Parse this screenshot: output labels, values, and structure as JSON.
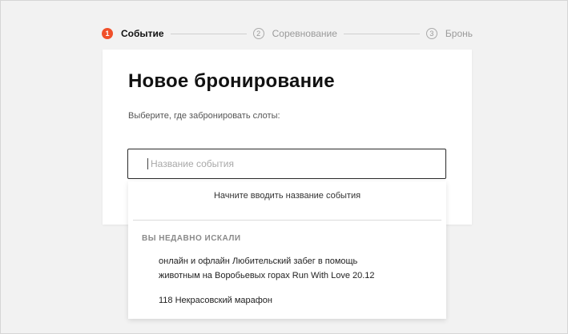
{
  "stepper": {
    "steps": [
      {
        "num": "1",
        "label": "Событие",
        "active": true
      },
      {
        "num": "2",
        "label": "Соревнование",
        "active": false
      },
      {
        "num": "3",
        "label": "Бронь",
        "active": false
      }
    ]
  },
  "card": {
    "title": "Новое бронирование",
    "subtitle": "Выберите, где забронировать слоты:"
  },
  "search": {
    "value": "",
    "placeholder": "Название события"
  },
  "dropdown": {
    "hint": "Начните вводить название события",
    "recent_heading": "ВЫ НЕДАВНО ИСКАЛИ",
    "recent_items": [
      "онлайн и офлайн Любительский забег в помощь животным на Воробьевых горах Run With Love 20.12",
      "118 Некрасовский марафон"
    ]
  },
  "colors": {
    "accent": "#f0502a",
    "background": "#f2f2f2"
  }
}
